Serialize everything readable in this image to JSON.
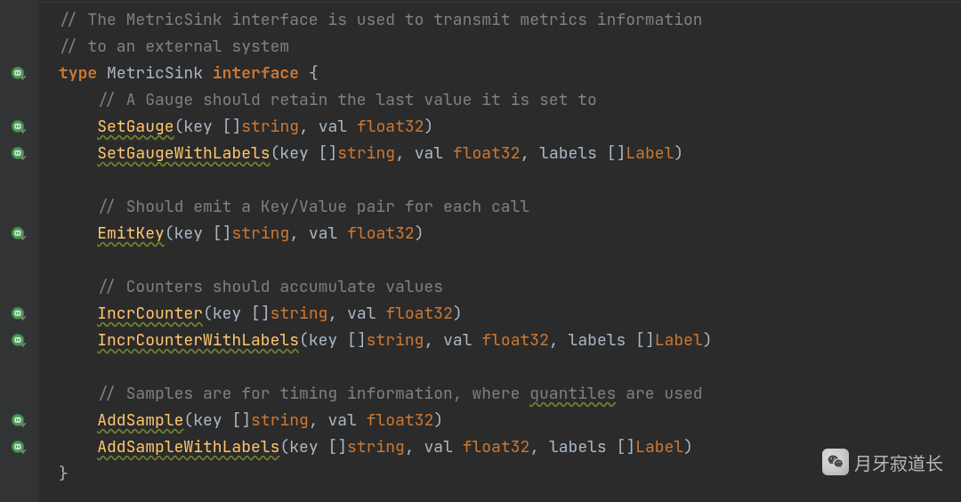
{
  "code": {
    "comment1": "// The MetricSink interface is used to transmit metrics information",
    "comment2": "// to an external system",
    "decl_type_kw": "type",
    "decl_name": "MetricSink",
    "decl_iface_kw": "interface",
    "decl_open": " {",
    "gauge_comment": "// A Gauge should retain the last value it is set to",
    "set_gauge": {
      "name": "SetGauge",
      "sig": "(key []string, val float32)"
    },
    "set_gauge_labels": {
      "name": "SetGaugeWithLabels",
      "sig": "(key []string, val float32, labels []Label)"
    },
    "emit_comment": "// Should emit a Key/Value pair for each call",
    "emit_key": {
      "name": "EmitKey",
      "sig": "(key []string, val float32)"
    },
    "counter_comment": "// Counters should accumulate values",
    "incr_counter": {
      "name": "IncrCounter",
      "sig": "(key []string, val float32)"
    },
    "incr_counter_labels": {
      "name": "IncrCounterWithLabels",
      "sig": "(key []string, val float32, labels []Label)"
    },
    "sample_comment_a": "// Samples are for timing information, where ",
    "sample_comment_warn": "quantiles",
    "sample_comment_b": " are used",
    "add_sample": {
      "name": "AddSample",
      "sig": "(key []string, val float32)"
    },
    "add_sample_labels": {
      "name": "AddSampleWithLabels",
      "sig": "(key []string, val float32, labels []Label)"
    },
    "close_brace": "}"
  },
  "gutter": {
    "impl_lines": [
      3,
      5,
      6,
      9,
      12,
      13,
      16,
      17
    ]
  },
  "watermark": {
    "text": "月牙寂道长"
  }
}
